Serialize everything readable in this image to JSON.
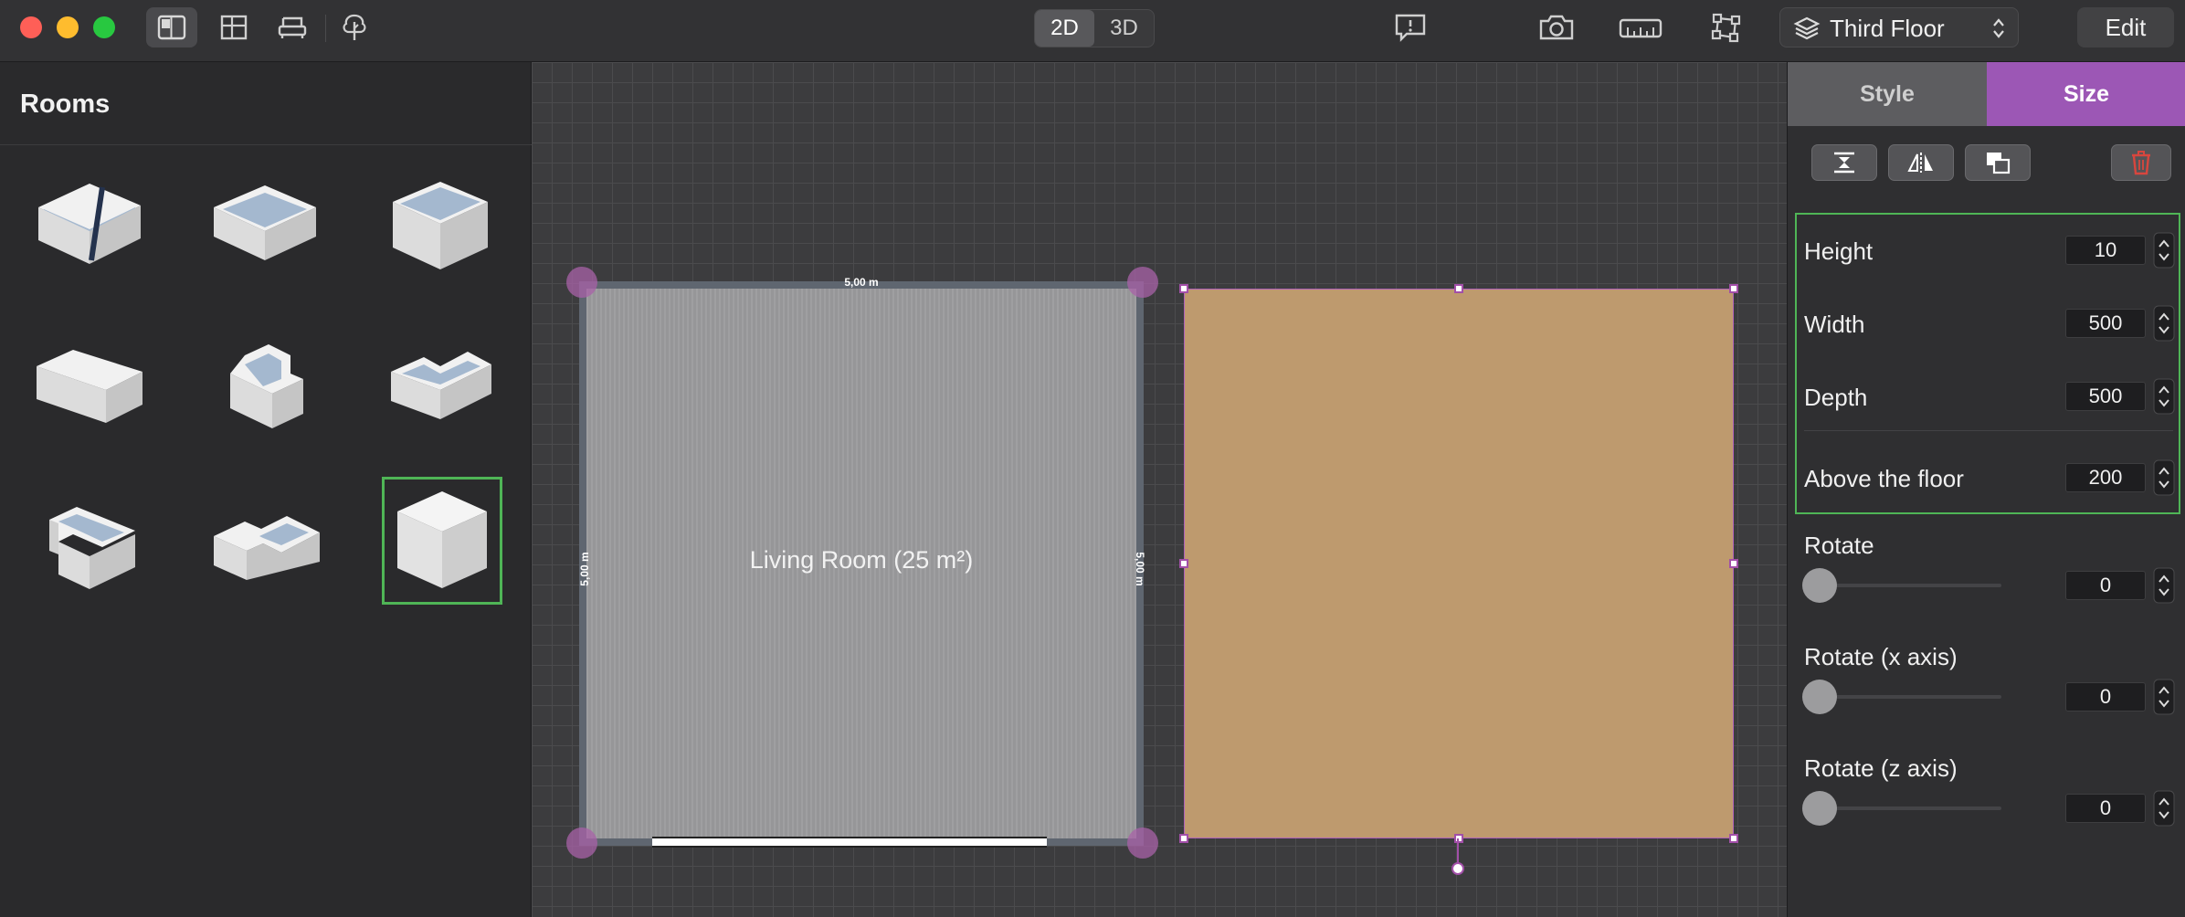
{
  "toolbar": {
    "view_toggle": {
      "option_2d": "2D",
      "option_3d": "3D",
      "selected": "2D"
    },
    "floor_selector": {
      "value": "Third Floor"
    },
    "edit_label": "Edit",
    "icons": [
      "sidebar-icon",
      "floorplan-icon",
      "furniture-icon",
      "tree-icon",
      "feedback-icon",
      "camera-icon",
      "ruler-icon",
      "transform-icon"
    ]
  },
  "left_panel": {
    "title": "Rooms",
    "templates": [
      "room-stairs",
      "room-square",
      "room-square-deep",
      "room-rect",
      "room-l-shape",
      "room-notch",
      "room-u-shape",
      "room-t-shape",
      "box"
    ],
    "selected_index": 8
  },
  "canvas": {
    "room_label": "Living Room (25 m²)",
    "dim_top": "5,00 m",
    "dim_left": "5,00 m",
    "dim_right": "5,00 m",
    "colors": {
      "floor": "#9b9b9d",
      "wall": "#5f6670",
      "selected_box": "#be9a6e",
      "selection": "#a24fa8"
    }
  },
  "inspector": {
    "tabs": {
      "style": "Style",
      "size": "Size",
      "active": "Size"
    },
    "props": {
      "height": {
        "label": "Height",
        "value": "10"
      },
      "width": {
        "label": "Width",
        "value": "500"
      },
      "depth": {
        "label": "Depth",
        "value": "500"
      },
      "above": {
        "label": "Above the floor",
        "value": "200"
      }
    },
    "rotations": {
      "rotate": {
        "label": "Rotate",
        "value": "0"
      },
      "rotate_x": {
        "label": "Rotate (x axis)",
        "value": "0"
      },
      "rotate_z": {
        "label": "Rotate (z axis)",
        "value": "0"
      }
    }
  }
}
